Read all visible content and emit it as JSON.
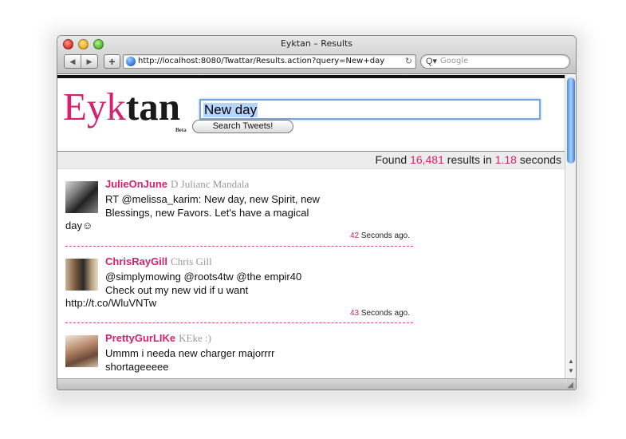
{
  "window": {
    "title": "Eyktan – Results"
  },
  "toolbar": {
    "back": "◀",
    "forward": "▶",
    "add": "+",
    "url": "http://localhost:8080/Twattar/Results.action?query=New+day",
    "reload": "↻",
    "search_placeholder": "Google"
  },
  "page": {
    "logo_part1": "Eyk",
    "logo_part2": "tan",
    "beta": "Beta",
    "query": "New day",
    "search_button": "Search Tweets!",
    "found_prefix": "Found ",
    "found_count": "16,481",
    "found_mid": " results in ",
    "found_time": "1.18",
    "found_suffix": " seconds"
  },
  "tweets": [
    {
      "username": "JulieOnJune",
      "realname": "D Julianc Mandala",
      "text": "RT @melissa_karim: New day, new Spirit, new Blessings, new Favors. Let's have a magical",
      "text_wrap": "day☺",
      "time_value": "42",
      "time_suffix": " Seconds ago."
    },
    {
      "username": "ChrisRayGill",
      "realname": "Chris Gill",
      "text": "@simplymowing @roots4tw @the empir40 Check out my new vid if u want",
      "text_wrap": "http://t.co/WluVNTw",
      "time_value": "43",
      "time_suffix": " Seconds ago."
    },
    {
      "username": "PrettyGurLIKe",
      "realname": "KEke :)",
      "text": "Ummm i needa new charger majorrrr shortageeeee",
      "text_wrap": "",
      "time_value": "",
      "time_suffix": ""
    }
  ],
  "colors": {
    "accent": "#d6226c",
    "focus": "#7aa6d6",
    "scroll": "#4a8de2"
  }
}
